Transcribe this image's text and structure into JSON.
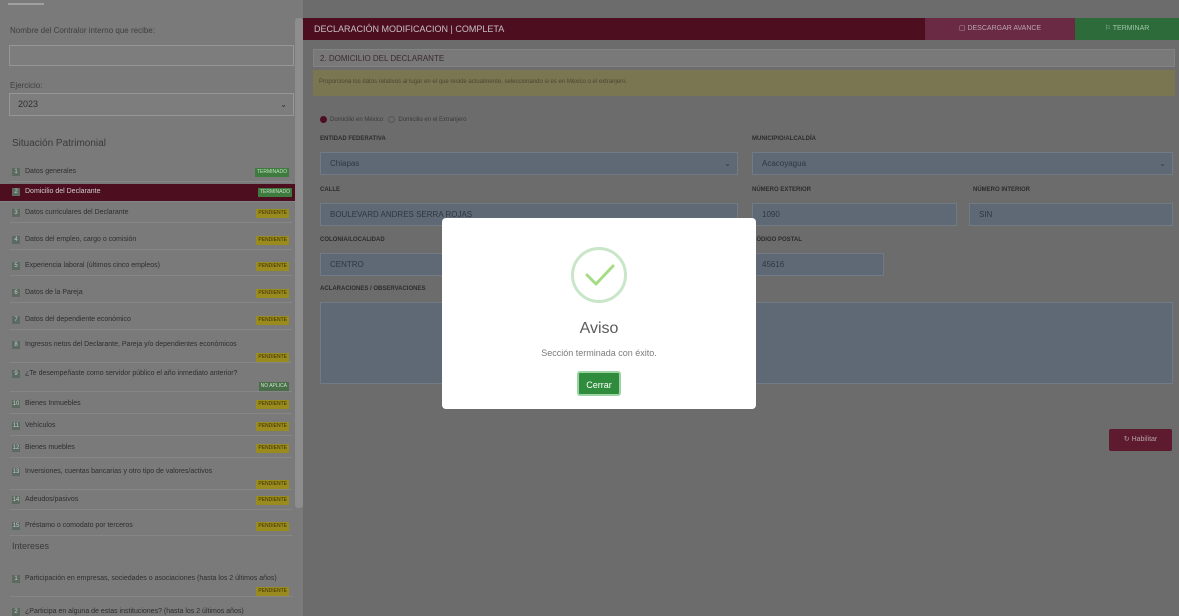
{
  "sidebar": {
    "contralor_label": "Nombre del Contralor interno que recibe:",
    "contralor_value": "",
    "ejercicio_label": "Ejercicio:",
    "ejercicio_value": "2023",
    "patrimonial_heading": "Situación Patrimonial",
    "intereses_heading": "Intereses",
    "items": [
      {
        "num": "1",
        "label": "Datos generales",
        "badge": "TERMINADO",
        "status": "ok"
      },
      {
        "num": "2",
        "label": "Domicilio del Declarante",
        "badge": "TERMINADO",
        "status": "ok"
      },
      {
        "num": "3",
        "label": "Datos curriculares del Declarante",
        "badge": "PENDIENTE",
        "status": "pending"
      },
      {
        "num": "4",
        "label": "Datos del empleo, cargo o comisión",
        "badge": "PENDIENTE",
        "status": "pending"
      },
      {
        "num": "5",
        "label": "Experiencia laboral (últimos cinco empleos)",
        "badge": "PENDIENTE",
        "status": "pending"
      },
      {
        "num": "6",
        "label": "Datos de la Pareja",
        "badge": "PENDIENTE",
        "status": "pending"
      },
      {
        "num": "7",
        "label": "Datos del dependiente económico",
        "badge": "PENDIENTE",
        "status": "pending"
      },
      {
        "num": "8",
        "label": "Ingresos netos del Declarante, Pareja y/o dependientes económicos",
        "badge": "PENDIENTE",
        "status": "pending"
      },
      {
        "num": "9",
        "label": "¿Te desempeñaste como servidor público el año inmediato anterior?",
        "badge": "NO APLICA",
        "status": "na"
      },
      {
        "num": "10",
        "label": "Bienes Inmuebles",
        "badge": "PENDIENTE",
        "status": "pending"
      },
      {
        "num": "11",
        "label": "Vehículos",
        "badge": "PENDIENTE",
        "status": "pending"
      },
      {
        "num": "12",
        "label": "Bienes muebles",
        "badge": "PENDIENTE",
        "status": "pending"
      },
      {
        "num": "13",
        "label": "Inversiones, cuentas bancarias y otro tipo de valores/activos",
        "badge": "PENDIENTE",
        "status": "pending"
      },
      {
        "num": "14",
        "label": "Adeudos/pasivos",
        "badge": "PENDIENTE",
        "status": "pending"
      },
      {
        "num": "15",
        "label": "Préstamo o comodato por terceros",
        "badge": "PENDIENTE",
        "status": "pending"
      }
    ],
    "interest_items": [
      {
        "num": "1",
        "label": "Participación en empresas, sociedades o asociaciones (hasta los 2 últimos años)",
        "badge": "PENDIENTE"
      },
      {
        "num": "2",
        "label": "¿Participa en alguna de estas instituciones? (hasta los 2 últimos años)",
        "badge": ""
      }
    ]
  },
  "header": {
    "title": "DECLARACIÓN MODIFICACION | COMPLETA",
    "download_label": "DESCARGAR AVANCE",
    "finish_label": "TERMINAR"
  },
  "section": {
    "heading": "2. DOMICILIO DEL DECLARANTE",
    "notice": "Proporciona los datos relativos al lugar en el que reside actualmente, seleccionando si es en México o el extranjero.",
    "radio_mexico": "Domicilio en México",
    "radio_abroad": "Domicilio en el Extranjero",
    "entidad_label": "ENTIDAD FEDERATIVA",
    "entidad_value": "Chiapas",
    "municipio_label": "MUNICIPIO/ALCALDÍA",
    "municipio_value": "Acacoyagua",
    "calle_label": "CALLE",
    "calle_value": "BOULEVARD ANDRES SERRA ROJAS",
    "num_ext_label": "NÚMERO EXTERIOR",
    "num_ext_value": "1090",
    "num_int_label": "NÚMERO INTERIOR",
    "num_int_value": "SIN",
    "colonia_label": "COLONIA/LOCALIDAD",
    "colonia_value": "CENTRO",
    "cp_label": "CÓDIGO POSTAL",
    "cp_value": "45616",
    "aclaraciones_label": "ACLARACIONES / OBSERVACIONES",
    "habilitar_label": "Habilitar"
  },
  "modal": {
    "title": "Aviso",
    "message": "Sección terminada con éxito.",
    "button": "Cerrar"
  },
  "colors": {
    "brand": "#6f1d35",
    "success": "#2f8c3c",
    "pending": "#d4be2a"
  }
}
